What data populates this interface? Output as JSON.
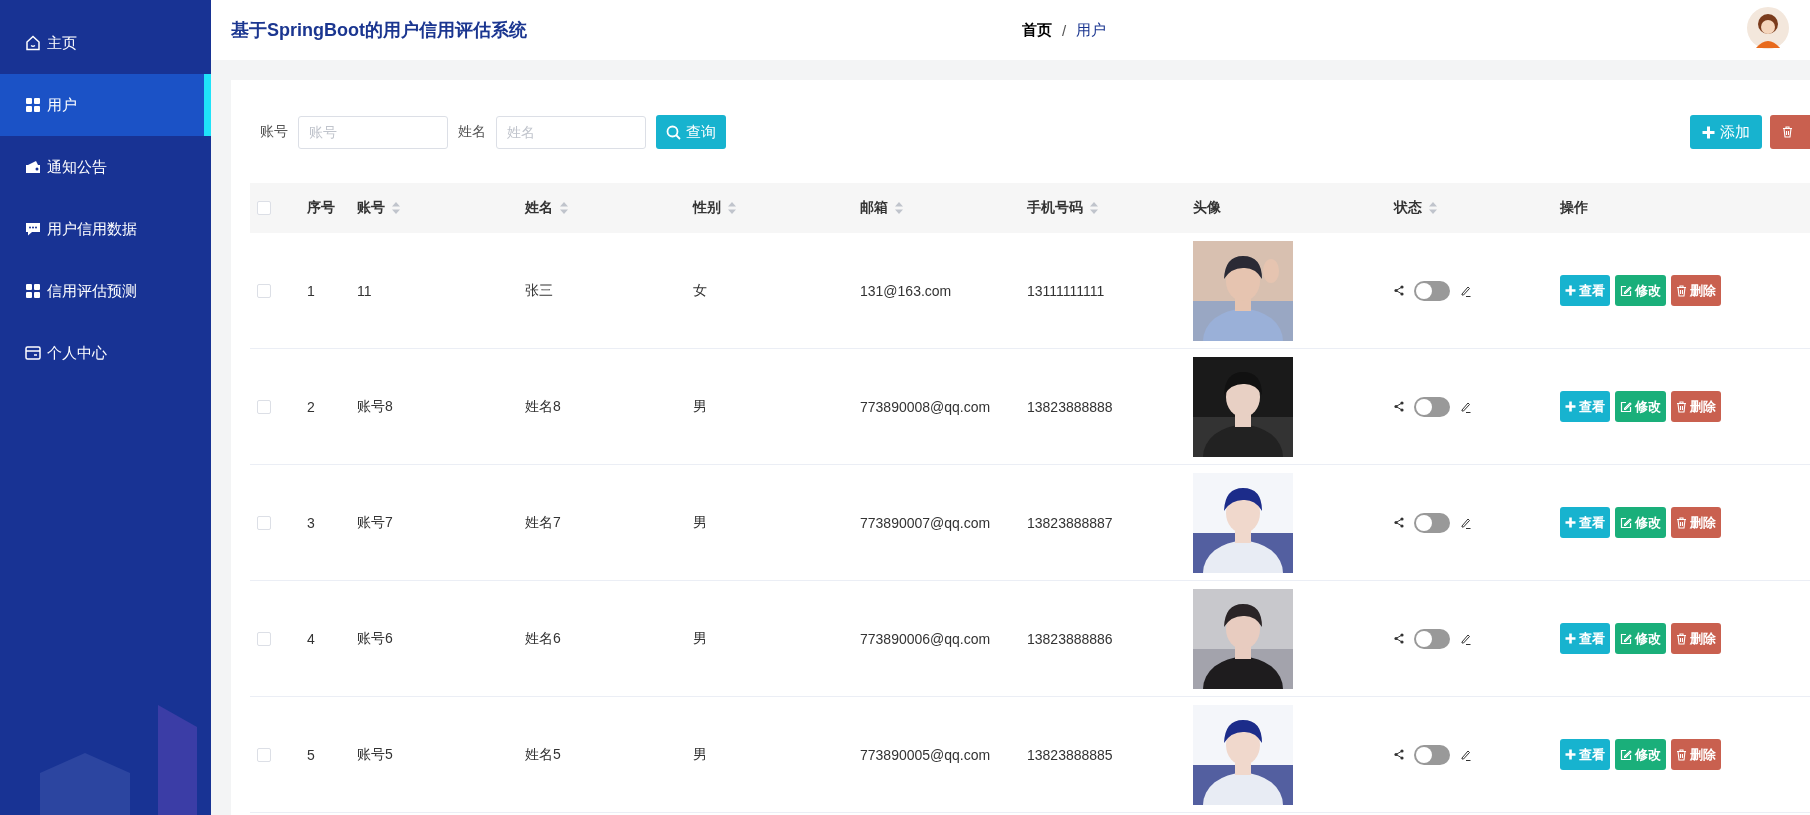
{
  "sidebar": {
    "items": [
      {
        "label": "主页",
        "kind": "home",
        "selected": false
      },
      {
        "label": "用户",
        "kind": "grid",
        "selected": true
      },
      {
        "label": "通知公告",
        "kind": "wallet",
        "selected": false
      },
      {
        "label": "用户信用数据",
        "kind": "chat",
        "selected": false
      },
      {
        "label": "信用评估预测",
        "kind": "grid",
        "selected": false
      },
      {
        "label": "个人中心",
        "kind": "card",
        "selected": false
      }
    ]
  },
  "header": {
    "title": "基于SpringBoot的用户信用评估系统",
    "separator": "/",
    "breadcrumb": [
      {
        "label": "首页",
        "current": false
      },
      {
        "label": "用户",
        "current": true
      }
    ]
  },
  "search": {
    "fields": [
      {
        "label": "账号",
        "placeholder": "账号"
      },
      {
        "label": "姓名",
        "placeholder": "姓名"
      }
    ],
    "button": "查询"
  },
  "toolbar": {
    "buttons": [
      {
        "kind": "add",
        "label": "添加"
      },
      {
        "kind": "delete"
      }
    ]
  },
  "table": {
    "select_all": false,
    "columns": [
      {
        "label": "序号",
        "sortable": false
      },
      {
        "label": "账号",
        "sortable": true
      },
      {
        "label": "姓名",
        "sortable": true
      },
      {
        "label": "性别",
        "sortable": true
      },
      {
        "label": "邮箱",
        "sortable": true
      },
      {
        "label": "手机号码",
        "sortable": true
      },
      {
        "label": "头像",
        "sortable": false
      },
      {
        "label": "状态",
        "sortable": true
      },
      {
        "label": "操作",
        "sortable": false
      }
    ],
    "rows": [
      {
        "checked": false,
        "cells": [
          "1",
          "11",
          "张三",
          "女",
          "131@163.com",
          "13111111111"
        ],
        "status_on": false,
        "actions": [
          {
            "kind": "view",
            "label": "查看"
          },
          {
            "kind": "edit",
            "label": "修改"
          },
          {
            "kind": "delete",
            "label": "删除"
          }
        ]
      },
      {
        "checked": false,
        "cells": [
          "2",
          "账号8",
          "姓名8",
          "男",
          "773890008@qq.com",
          "13823888888"
        ],
        "status_on": false,
        "actions": [
          {
            "kind": "view",
            "label": "查看"
          },
          {
            "kind": "edit",
            "label": "修改"
          },
          {
            "kind": "delete",
            "label": "删除"
          }
        ]
      },
      {
        "checked": false,
        "cells": [
          "3",
          "账号7",
          "姓名7",
          "男",
          "773890007@qq.com",
          "13823888887"
        ],
        "status_on": false,
        "actions": [
          {
            "kind": "view",
            "label": "查看"
          },
          {
            "kind": "edit",
            "label": "修改"
          },
          {
            "kind": "delete",
            "label": "删除"
          }
        ]
      },
      {
        "checked": false,
        "cells": [
          "4",
          "账号6",
          "姓名6",
          "男",
          "773890006@qq.com",
          "13823888886"
        ],
        "status_on": false,
        "actions": [
          {
            "kind": "view",
            "label": "查看"
          },
          {
            "kind": "edit",
            "label": "修改"
          },
          {
            "kind": "delete",
            "label": "删除"
          }
        ]
      },
      {
        "checked": false,
        "cells": [
          "5",
          "账号5",
          "姓名5",
          "男",
          "773890005@qq.com",
          "13823888885"
        ],
        "status_on": false,
        "actions": [
          {
            "kind": "view",
            "label": "查看"
          },
          {
            "kind": "edit",
            "label": "修改"
          },
          {
            "kind": "delete",
            "label": "删除"
          }
        ]
      }
    ]
  }
}
